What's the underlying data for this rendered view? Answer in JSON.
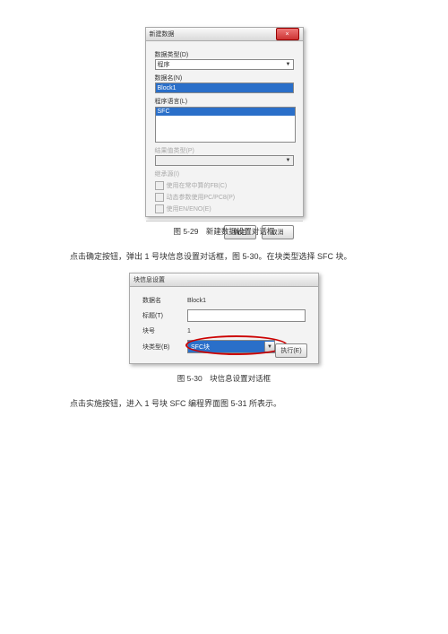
{
  "dlg1": {
    "title": "新建数据",
    "close": "×",
    "dataTypeLabel": "数据类型(D)",
    "dataTypeValue": "程序",
    "dataNameLabel": "数据名(N)",
    "dataNameValue": "Block1",
    "progLangLabel": "程序语言(L)",
    "progLangValue": "SFC",
    "retTypeLabel": "结果值类型(P)",
    "inheritLabel": "继承源(I)",
    "chk1": "使用在常中算的FB(C)",
    "chk2": "动态参数使用PC/PC8(P)",
    "chk3": "使用EN/ENO(E)",
    "ok": "确定",
    "cancel": "取消"
  },
  "cap1": "图 5-29　新建数据设置对话框",
  "para1": "点击确定按钮，弹出 1 号块信息设置对话框，图 5-30。在块类型选择 SFC 块。",
  "dlg2": {
    "title": "块信息设置",
    "dataName": "数据名",
    "dataNameValue": "Block1",
    "titleLbl": "标题(T)",
    "blockNo": "块号",
    "blockNoValue": "1",
    "blockType": "块类型(B)",
    "blockTypeValue": "SFC块",
    "execute": "执行(E)"
  },
  "cap2": "图 5-30　块信息设置对话框",
  "para2": "点击实施按钮，进入 1 号块 SFC 编程界面图 5-31 所表示。"
}
